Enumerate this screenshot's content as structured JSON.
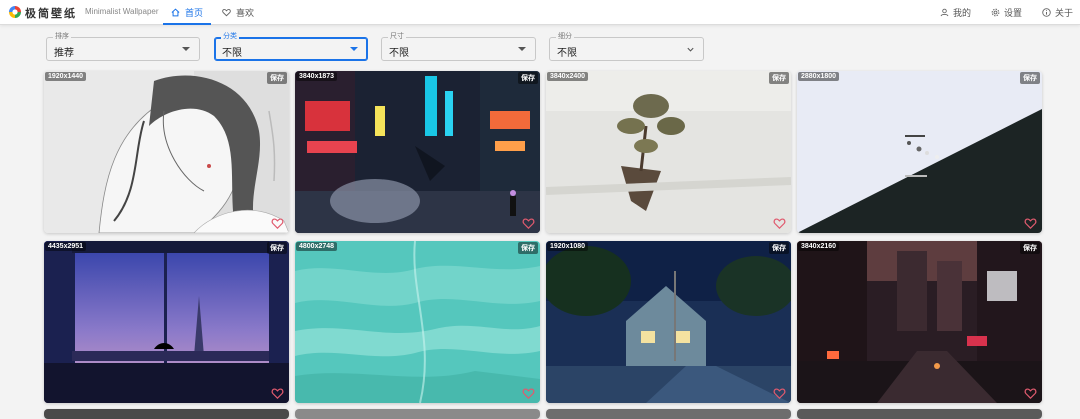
{
  "header": {
    "brand": "极简壁纸",
    "subtitle": "Minimalist Wallpaper",
    "tabs": [
      {
        "label": "首页",
        "icon": "home-icon",
        "active": true
      },
      {
        "label": "喜欢",
        "icon": "heart-icon",
        "active": false
      }
    ],
    "links": [
      {
        "label": "我的",
        "icon": "user-icon"
      },
      {
        "label": "设置",
        "icon": "gear-icon"
      },
      {
        "label": "关于",
        "icon": "info-icon"
      }
    ]
  },
  "filters": [
    {
      "label": "排序",
      "value": "推荐"
    },
    {
      "label": "分类",
      "value": "不限"
    },
    {
      "label": "尺寸",
      "value": "不限"
    },
    {
      "label": "细分",
      "value": "不限"
    }
  ],
  "gallery": {
    "save_label": "保存",
    "items": [
      {
        "resolution": "1920x1440",
        "subject": "sketch-girl"
      },
      {
        "resolution": "3840x1873",
        "subject": "neon-city"
      },
      {
        "resolution": "3840x2400",
        "subject": "floating-tree"
      },
      {
        "resolution": "2880x1800",
        "subject": "life-death-diagonal"
      },
      {
        "resolution": "4435x2951",
        "subject": "paris-window"
      },
      {
        "resolution": "4800x2748",
        "subject": "teal-ocean"
      },
      {
        "resolution": "1920x1080",
        "subject": "night-street"
      },
      {
        "resolution": "3840x2160",
        "subject": "cyberpunk-alley"
      }
    ]
  },
  "theme": {
    "accent": "#1a73e8",
    "background": "#f3f3f3"
  }
}
